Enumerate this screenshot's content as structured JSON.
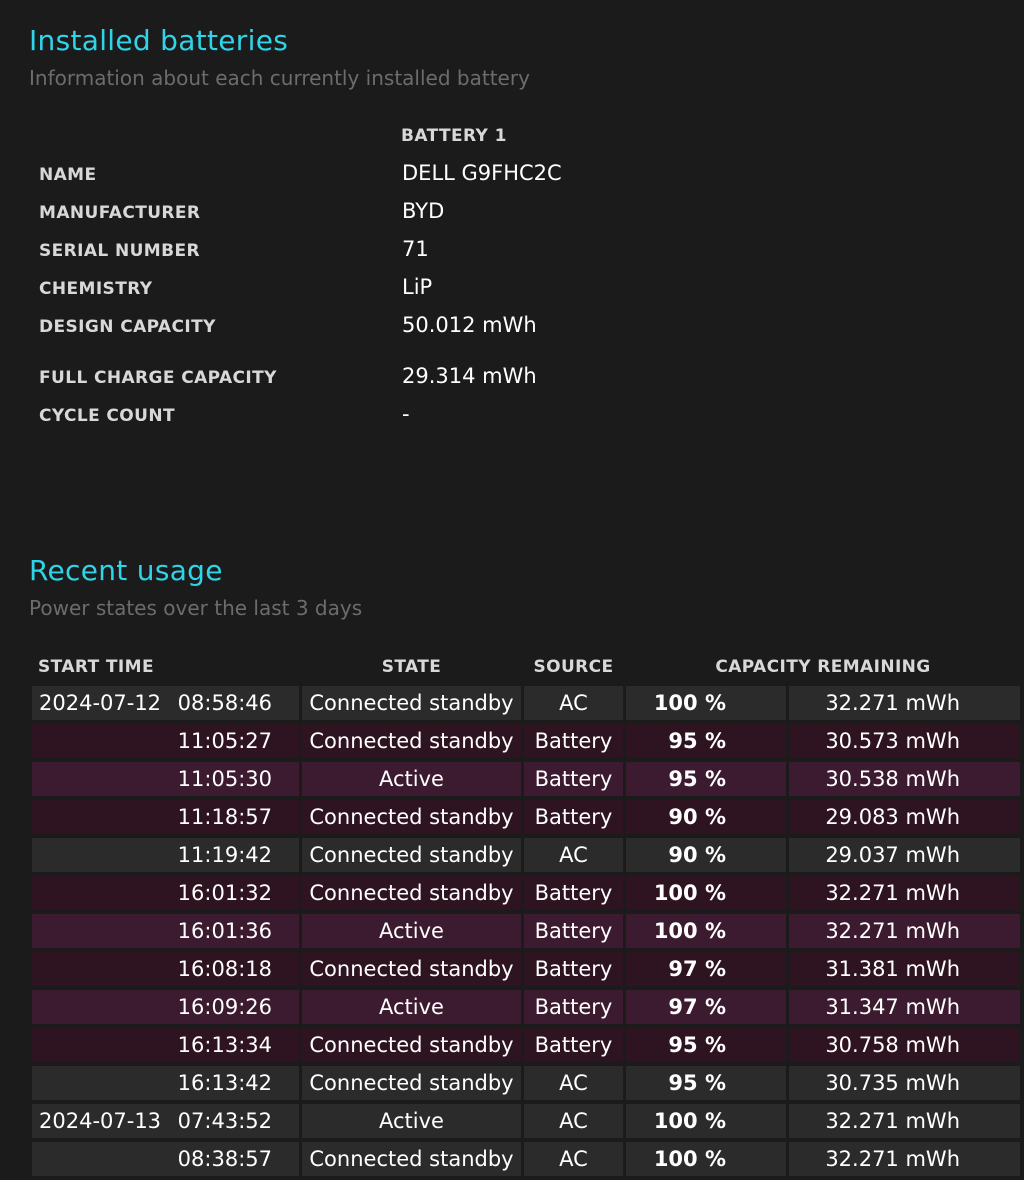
{
  "installed": {
    "title": "Installed batteries",
    "subtitle": "Information about each currently installed battery",
    "battery_header": "BATTERY 1",
    "fields": [
      {
        "label": "NAME",
        "value": "DELL G9FHC2C"
      },
      {
        "label": "MANUFACTURER",
        "value": "BYD"
      },
      {
        "label": "SERIAL NUMBER",
        "value": "71"
      },
      {
        "label": "CHEMISTRY",
        "value": "LiP"
      },
      {
        "label": "DESIGN CAPACITY",
        "value": "50.012 mWh"
      },
      {
        "label": "FULL CHARGE CAPACITY",
        "value": "29.314 mWh"
      },
      {
        "label": "CYCLE COUNT",
        "value": "-"
      }
    ]
  },
  "recent": {
    "title": "Recent usage",
    "subtitle": "Power states over the last 3 days",
    "columns": {
      "start_time": "START TIME",
      "state": "STATE",
      "source": "SOURCE",
      "capacity_remaining": "CAPACITY REMAINING"
    },
    "colors": {
      "ac_row": "#2b2b2b",
      "battery_standby_row": "#2e1420",
      "battery_active_row": "#3c1a2f",
      "accent_title": "#2fd4e8"
    },
    "rows": [
      {
        "date": "2024-07-12",
        "time": "08:58:46",
        "state": "Connected standby",
        "source": "AC",
        "percent": "100 %",
        "capacity": "32.271 mWh"
      },
      {
        "date": "",
        "time": "11:05:27",
        "state": "Connected standby",
        "source": "Battery",
        "percent": "95 %",
        "capacity": "30.573 mWh"
      },
      {
        "date": "",
        "time": "11:05:30",
        "state": "Active",
        "source": "Battery",
        "percent": "95 %",
        "capacity": "30.538 mWh"
      },
      {
        "date": "",
        "time": "11:18:57",
        "state": "Connected standby",
        "source": "Battery",
        "percent": "90 %",
        "capacity": "29.083 mWh"
      },
      {
        "date": "",
        "time": "11:19:42",
        "state": "Connected standby",
        "source": "AC",
        "percent": "90 %",
        "capacity": "29.037 mWh"
      },
      {
        "date": "",
        "time": "16:01:32",
        "state": "Connected standby",
        "source": "Battery",
        "percent": "100 %",
        "capacity": "32.271 mWh"
      },
      {
        "date": "",
        "time": "16:01:36",
        "state": "Active",
        "source": "Battery",
        "percent": "100 %",
        "capacity": "32.271 mWh"
      },
      {
        "date": "",
        "time": "16:08:18",
        "state": "Connected standby",
        "source": "Battery",
        "percent": "97 %",
        "capacity": "31.381 mWh"
      },
      {
        "date": "",
        "time": "16:09:26",
        "state": "Active",
        "source": "Battery",
        "percent": "97 %",
        "capacity": "31.347 mWh"
      },
      {
        "date": "",
        "time": "16:13:34",
        "state": "Connected standby",
        "source": "Battery",
        "percent": "95 %",
        "capacity": "30.758 mWh"
      },
      {
        "date": "",
        "time": "16:13:42",
        "state": "Connected standby",
        "source": "AC",
        "percent": "95 %",
        "capacity": "30.735 mWh"
      },
      {
        "date": "2024-07-13",
        "time": "07:43:52",
        "state": "Active",
        "source": "AC",
        "percent": "100 %",
        "capacity": "32.271 mWh"
      },
      {
        "date": "",
        "time": "08:38:57",
        "state": "Connected standby",
        "source": "AC",
        "percent": "100 %",
        "capacity": "32.271 mWh"
      }
    ]
  }
}
